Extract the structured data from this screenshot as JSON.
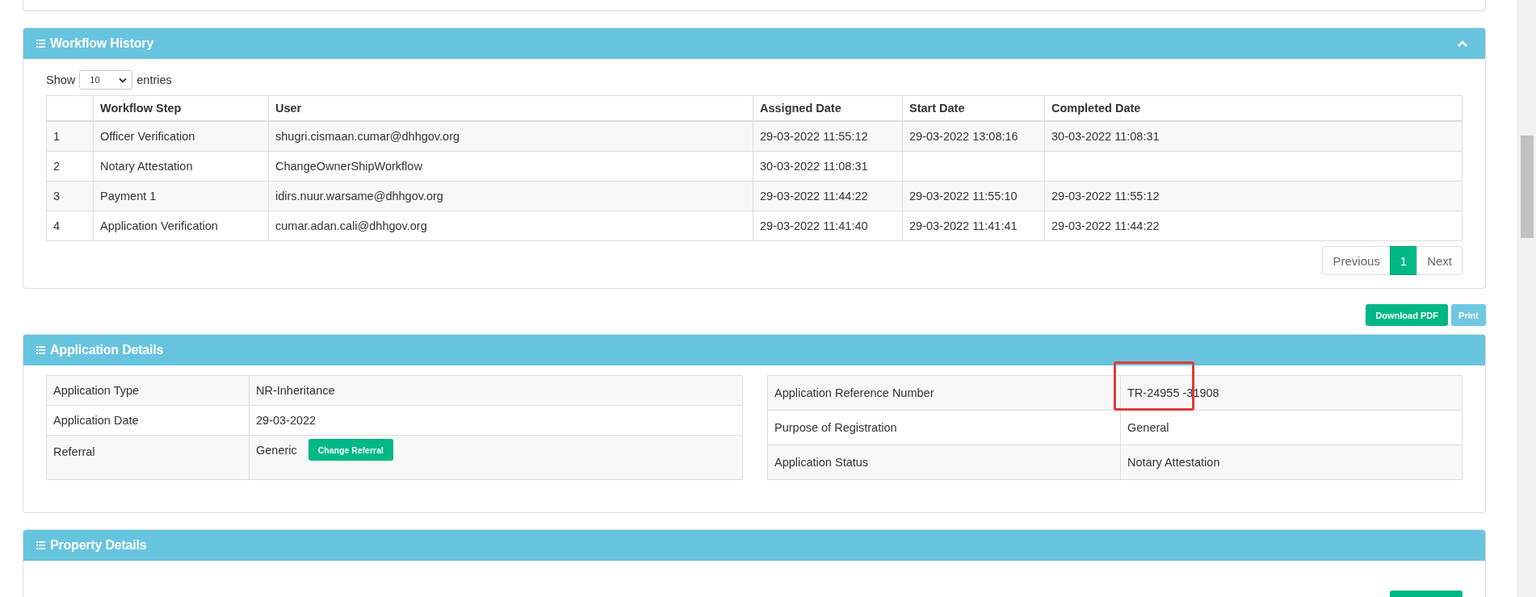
{
  "workflow_history": {
    "title": "Workflow History",
    "show_label": "Show",
    "page_size": "10",
    "entries_label": "entries",
    "columns": [
      "",
      "Workflow Step",
      "User",
      "Assigned Date",
      "Start Date",
      "Completed Date"
    ],
    "rows": [
      [
        "1",
        "Officer Verification",
        "shugri.cismaan.cumar@dhhgov.org",
        "29-03-2022 11:55:12",
        "29-03-2022 13:08:16",
        "30-03-2022 11:08:31"
      ],
      [
        "2",
        "Notary Attestation",
        "ChangeOwnerShipWorkflow",
        "30-03-2022 11:08:31",
        "",
        ""
      ],
      [
        "3",
        "Payment 1",
        "idirs.nuur.warsame@dhhgov.org",
        "29-03-2022 11:44:22",
        "29-03-2022 11:55:10",
        "29-03-2022 11:55:12"
      ],
      [
        "4",
        "Application Verification",
        "cumar.adan.cali@dhhgov.org",
        "29-03-2022 11:41:40",
        "29-03-2022 11:41:41",
        "29-03-2022 11:44:22"
      ]
    ],
    "pagination": {
      "previous": "Previous",
      "pages": [
        {
          "label": "1",
          "selected": true
        }
      ],
      "next": "Next"
    }
  },
  "actions": [
    "Download PDF",
    "Print"
  ],
  "application_details": {
    "title": "Application Details",
    "left": [
      {
        "label": "Application Type",
        "value": "NR-Inheritance"
      },
      {
        "label": "Application Date",
        "value": "29-03-2022"
      },
      {
        "label": "Referral",
        "value": "Generic",
        "button": "Change Referral"
      }
    ],
    "right": [
      {
        "label": "Application Reference Number",
        "value": "TR-24955 -31908",
        "highlighted": true
      },
      {
        "label": "Purpose of Registration",
        "value": "General",
        "highlighted": false
      },
      {
        "label": "Application Status",
        "value": "Notary Attestation",
        "highlighted": false
      }
    ]
  },
  "property_details": {
    "title": "Property Details"
  }
}
